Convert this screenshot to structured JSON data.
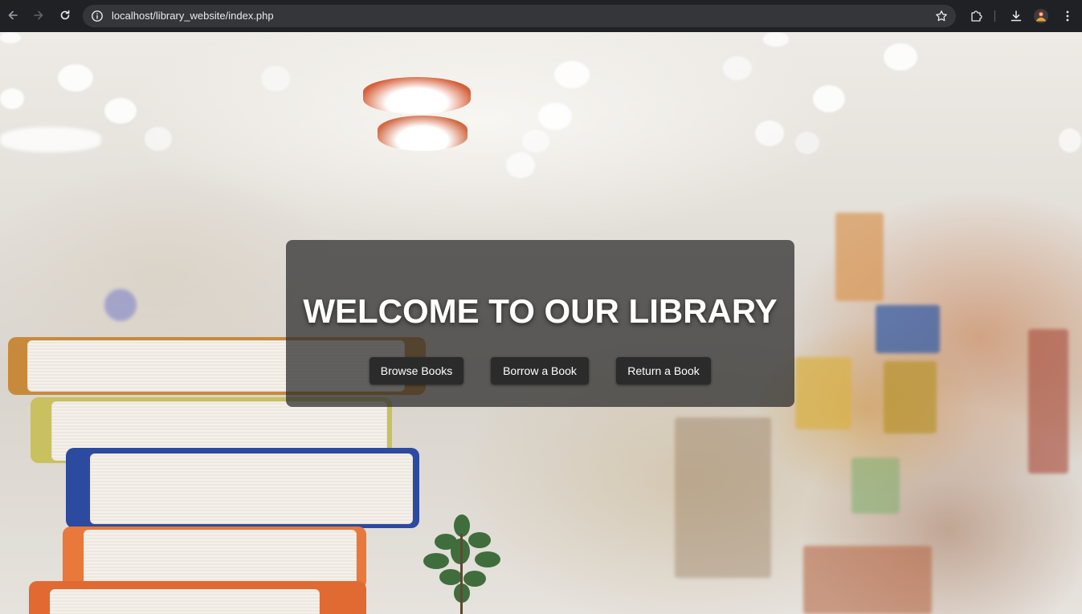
{
  "browser": {
    "url": "localhost/library_website/index.php",
    "icons": {
      "back": "arrow-left-icon",
      "forward": "arrow-right-icon",
      "reload": "reload-icon",
      "site_info": "info-icon",
      "bookmark": "star-icon",
      "extensions": "puzzle-icon",
      "downloads": "download-icon",
      "profile": "avatar",
      "menu": "kebab-menu-icon"
    }
  },
  "hero": {
    "title": "WELCOME TO OUR LIBRARY",
    "buttons": {
      "browse": "Browse Books",
      "borrow": "Borrow a Book",
      "return": "Return a Book"
    }
  },
  "colors": {
    "chrome_bg": "#202124",
    "omnibox_bg": "#35363a",
    "hero_overlay": "rgba(40,40,40,0.72)",
    "button_bg": "#2b2b2b",
    "text": "#ffffff"
  }
}
